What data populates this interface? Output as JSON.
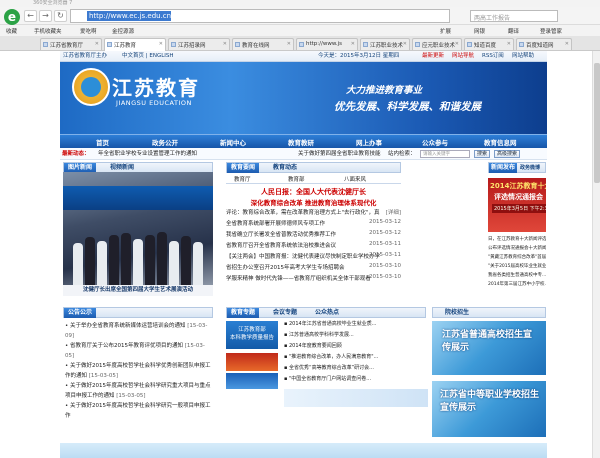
{
  "browser": {
    "title": "360安全浏览器 7",
    "back": "←",
    "forward": "→",
    "refresh": "↻",
    "url": "http://www.ec.js.edu.cn/",
    "search_placeholder": "两高工作报告",
    "right_tools": [
      "网银",
      "截图",
      "翻译"
    ],
    "favbar": [
      "收藏",
      "手机收藏夹",
      "爱吃啊",
      "金控源源"
    ],
    "favbar_right": [
      "扩展",
      "网银",
      "翻译",
      "登录管家"
    ],
    "tabs": [
      "江苏省教育厅",
      "江苏教育",
      "江苏招录网",
      "教育在线网",
      "http://www.js",
      "江苏职业技术",
      "应元职业技术",
      "知道百度",
      "百度知道网"
    ]
  },
  "page": {
    "topstrip": {
      "left": "江苏省教育厅主办",
      "lang": "中文首页 | ENGLISH",
      "date": "今天是：2015年3月12日 星期四",
      "links": [
        "最新更新",
        "网站导航",
        "RSS订阅",
        "网站帮助"
      ]
    },
    "banner": {
      "title": "江苏教育",
      "subtitle": "JIANGSU EDUCATION",
      "slogan1": "大力推进教育事业",
      "slogan2": "优先发展、科学发展、和谐发展"
    },
    "nav": [
      "首页",
      "政务公开",
      "新闻中心",
      "教育教研",
      "网上办事",
      "公众参与",
      "教育信息网"
    ],
    "newsbar": {
      "label": "最新动态：",
      "item1": "年全省职业学校专业设置管理工作的通知",
      "item2": "关于做好第四届全省职业教育技能",
      "site_search": "站内检索：",
      "search_placeholder": "请输入关键字",
      "search_btn": "搜索",
      "adv_btn": "高级搜索"
    },
    "left_tabs": [
      "图片新闻",
      "视频新闻"
    ],
    "photo_caption": "沈健厅长出席全国第四届大学生艺术展演活动",
    "mid_tabs": [
      "教育要闻",
      "教育动态"
    ],
    "mid_subtabs": [
      "教育厅",
      "教育部",
      "八面来风"
    ],
    "headline1": "人民日报：全国人大代表沈健厅长",
    "headline2": "深化教育综合改革 推进教育治理体系现代化",
    "mid_list": [
      {
        "t": "评论：教育综合改革，需在改革教育治理方式上\"去行政化\"，真",
        "d": "[详细]"
      },
      {
        "t": "全省教育系统部署开展师德师风专项工作",
        "d": "2015-03-12"
      },
      {
        "t": "我省确立厅长署发全省普教活动优秀推荐工作",
        "d": "2015-03-12"
      },
      {
        "t": "省教育厅召开全省教育系统依法治校推进会议",
        "d": "2015-03-11"
      },
      {
        "t": "【关注两会】中国教育报：沈健代表建议尽快制定职业学校办学",
        "d": "2015-03-11"
      },
      {
        "t": "省招生办公室召开2015年高考大学生专场招聘会",
        "d": "2015-03-10"
      },
      {
        "t": "学服来精神 做时代先锋——省教育厅组织机关全体干部观看",
        "d": "2015-03-10"
      }
    ],
    "right_tabs": [
      "新闻发布",
      "政务微博"
    ],
    "right_banner": {
      "a": "2014江苏教育十大新闻",
      "b": "评选情况通报会",
      "c": "2015年3月5日 下午2:30"
    },
    "right_list": [
      "日，在江苏教育十大新闻评选工作发布会，今年...",
      "公布评选情况通报会十大新闻...",
      "\"黄藏江苏教育综合改革\"首届...",
      "\"关于2015届高校毕业生就业...",
      "我省各类招生普通高校中专...",
      "2014年第三届江苏中小学校..."
    ],
    "gonggao_tab": "公告公示",
    "gonggao": [
      "关于举办全省教育系统新媒体运营培训会的通知",
      "省教育厅关于公布2015年教育评优项目的通知",
      "关于做好2015年度高校哲学社会科学优秀创新团队申报工作的通知",
      "关于做好2015年度高校哲学社会科学研究重大项目与重点项目申报工作的通知",
      "关于做好2015年度高校哲学社会科学研究一般项目申报工作"
    ],
    "gonggao_dates": [
      "[15-03-09]",
      "[15-03-05]",
      "[15-03-05]",
      "[15-03-05]",
      ""
    ],
    "mid2_tabs": [
      "教育专题",
      "会议专题",
      "公众热点"
    ],
    "mid2_left": [
      "江苏教育部",
      "本科教学质量报告"
    ],
    "mid2_list": [
      "2014年江苏省普通高校毕业生就业质...",
      "江苏普通高校学科科学发展...",
      "2014年度教育要闻回顾",
      "\"推进教育综合改革，办人民满意教育\"...",
      "全省优秀“高等教育综合改革”研讨会...",
      "\"中国全省教育厅门户网站调查问卷..."
    ],
    "notice_tab": "院校招生",
    "promo1": "江苏省普通高校招生宣传展示",
    "promo2": "江苏省中等职业学校招生宣传展示"
  }
}
